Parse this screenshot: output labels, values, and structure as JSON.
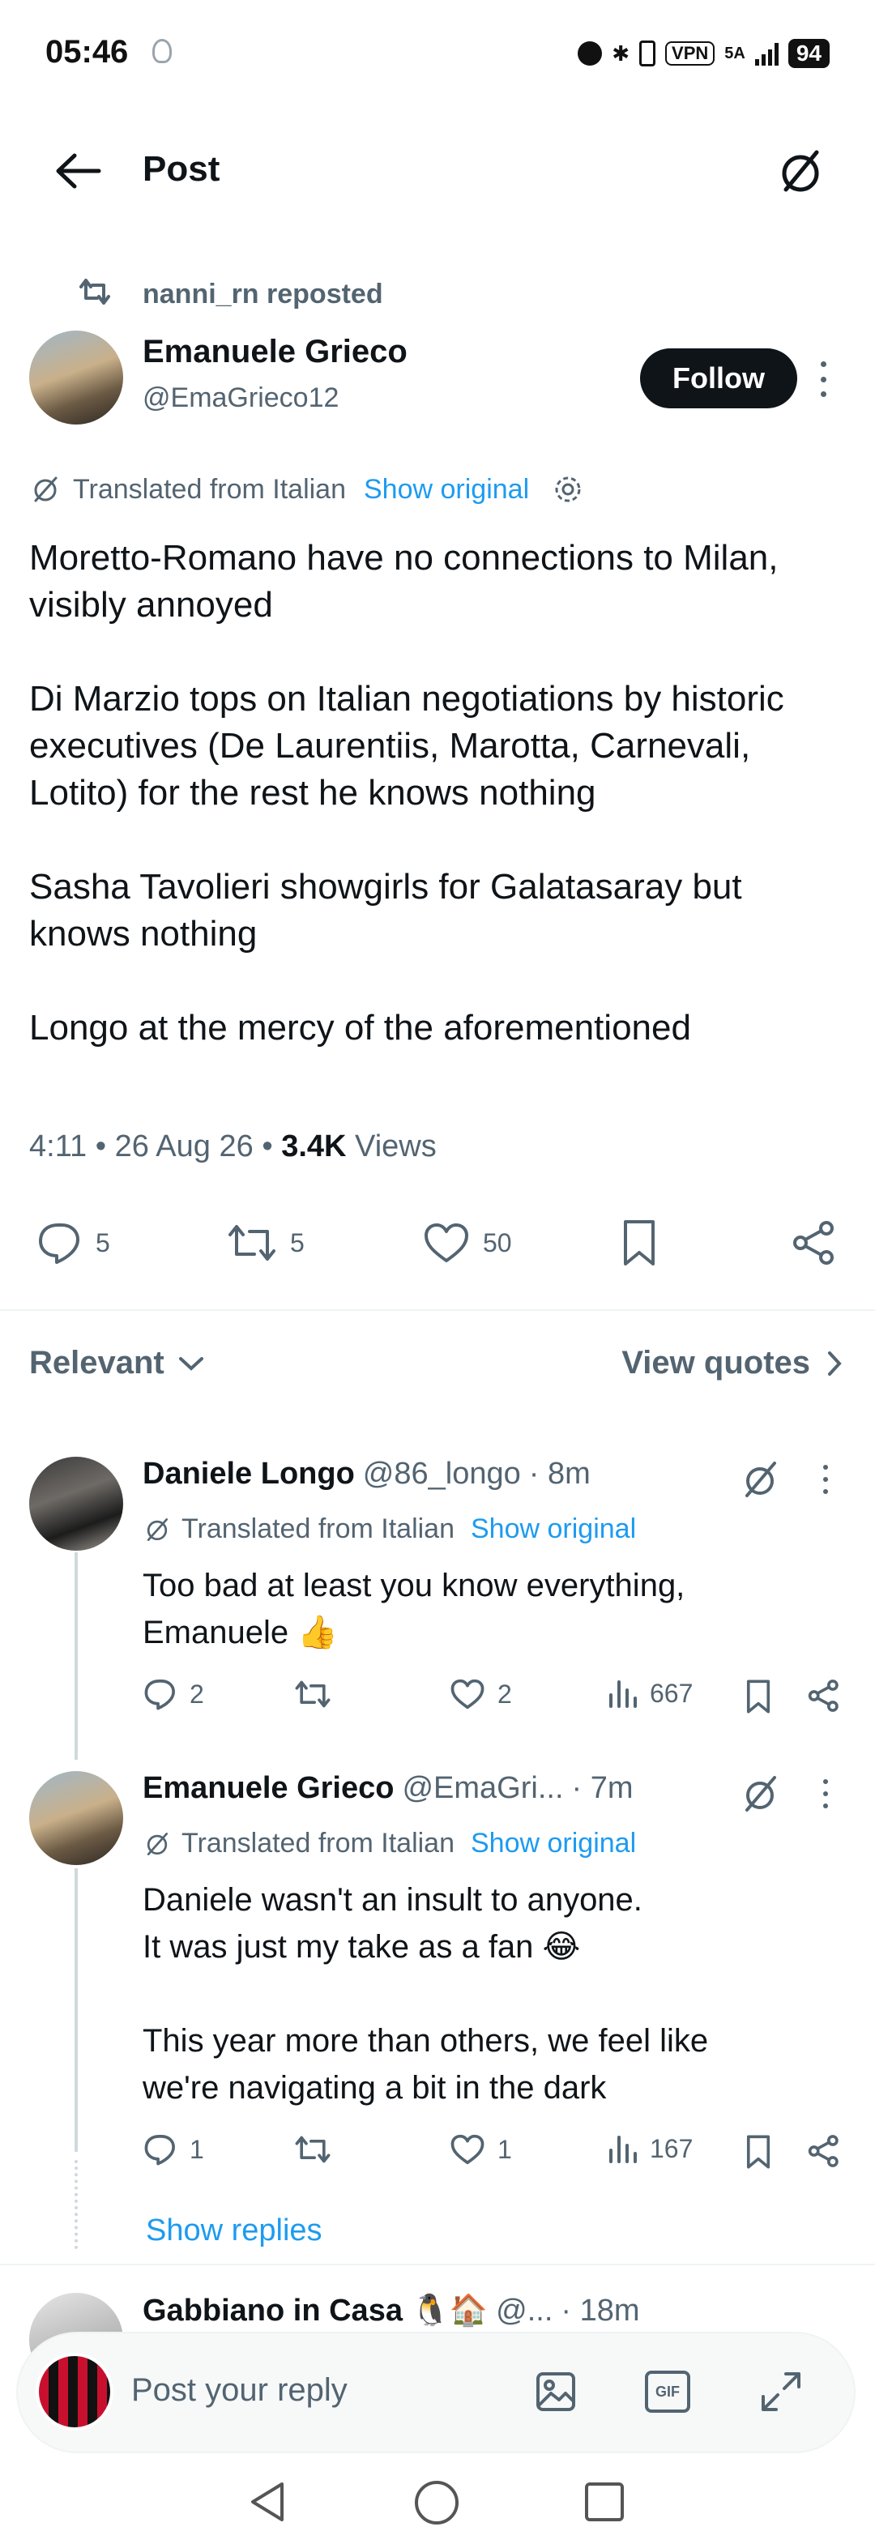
{
  "status_bar": {
    "time": "05:46",
    "vpn": "VPN",
    "network": "5A",
    "battery": "94"
  },
  "header": {
    "title": "Post"
  },
  "post": {
    "repost_by": "nanni_rn reposted",
    "author_name": "Emanuele Grieco",
    "author_handle": "@EmaGrieco12",
    "follow_label": "Follow",
    "translated_label": "Translated from Italian",
    "show_original_label": "Show original",
    "body": "Moretto-Romano have no connections to Milan, visibly annoyed\n\nDi Marzio tops on Italian negotiations by historic executives (De Laurentiis, Marotta, Carnevali, Lotito) for the rest he knows nothing\n\nSasha Tavolieri showgirls for Galatasaray but knows nothing\n\nLongo at the mercy of the aforementioned",
    "time": "4:11",
    "date": "26 Aug 26",
    "views_count": "3.4K",
    "views_label": "Views",
    "replies": "5",
    "reposts": "5",
    "likes": "50"
  },
  "sort": {
    "relevant_label": "Relevant",
    "view_quotes_label": "View quotes"
  },
  "replies": [
    {
      "name": "Daniele Longo",
      "handle": "@86_longo",
      "time": "· 8m",
      "translated_label": "Translated from Italian",
      "show_original_label": "Show original",
      "body": "Too bad at least you know everything,\nEmanuele 👍",
      "replies": "2",
      "likes": "2",
      "views": "667"
    },
    {
      "name": "Emanuele Grieco",
      "handle": "@EmaGri...",
      "time": "· 7m",
      "translated_label": "Translated from Italian",
      "show_original_label": "Show original",
      "body": "Daniele wasn't an insult to anyone.\nIt was just my take as a fan 😂\n\nThis year more than others, we feel like\nwe're navigating a bit in the dark",
      "replies": "1",
      "likes": "1",
      "views": "167"
    },
    {
      "name": "Gabbiano in Casa 🐧🏠",
      "handle": "@...",
      "time": "· 18m"
    }
  ],
  "show_replies_label": "Show replies",
  "composer": {
    "placeholder": "Post your reply"
  }
}
